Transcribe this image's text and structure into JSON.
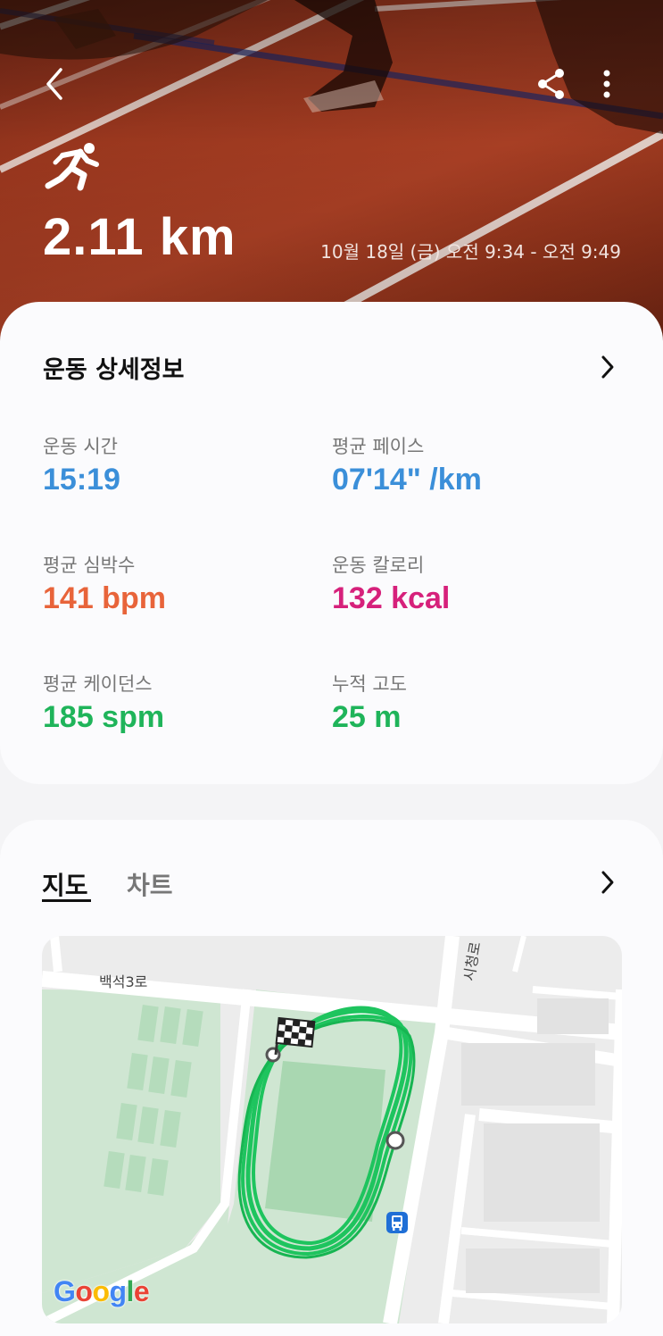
{
  "header": {
    "distance": "2.11 km",
    "date_range": "10월 18일 (금) 오전 9:34 - 오전 9:49",
    "icons": [
      "back-icon",
      "share-icon",
      "more-icon",
      "running-icon"
    ]
  },
  "details": {
    "title": "운동 상세정보",
    "stats": [
      {
        "label": "운동 시간",
        "value": "15:19",
        "color": "#3b8fd9"
      },
      {
        "label": "평균 페이스",
        "value": "07'14\" /km",
        "color": "#3b8fd9"
      },
      {
        "label": "평균 심박수",
        "value": "141 bpm",
        "color": "#e8643a"
      },
      {
        "label": "운동 칼로리",
        "value": "132 kcal",
        "color": "#d6217b"
      },
      {
        "label": "평균 케이던스",
        "value": "185 spm",
        "color": "#1fb45a"
      },
      {
        "label": "누적 고도",
        "value": "25 m",
        "color": "#1fb45a"
      }
    ]
  },
  "map_section": {
    "tabs": [
      {
        "label": "지도",
        "active": true
      },
      {
        "label": "차트",
        "active": false
      }
    ],
    "road_labels": [
      "백석3로",
      "시청로"
    ],
    "attribution": [
      "G",
      "o",
      "o",
      "g",
      "l",
      "e"
    ],
    "attribution_colors": [
      "#4285f4",
      "#ea4335",
      "#fbbc05",
      "#4285f4",
      "#34a853",
      "#ea4335"
    ],
    "route_color": "#1ec45e"
  }
}
